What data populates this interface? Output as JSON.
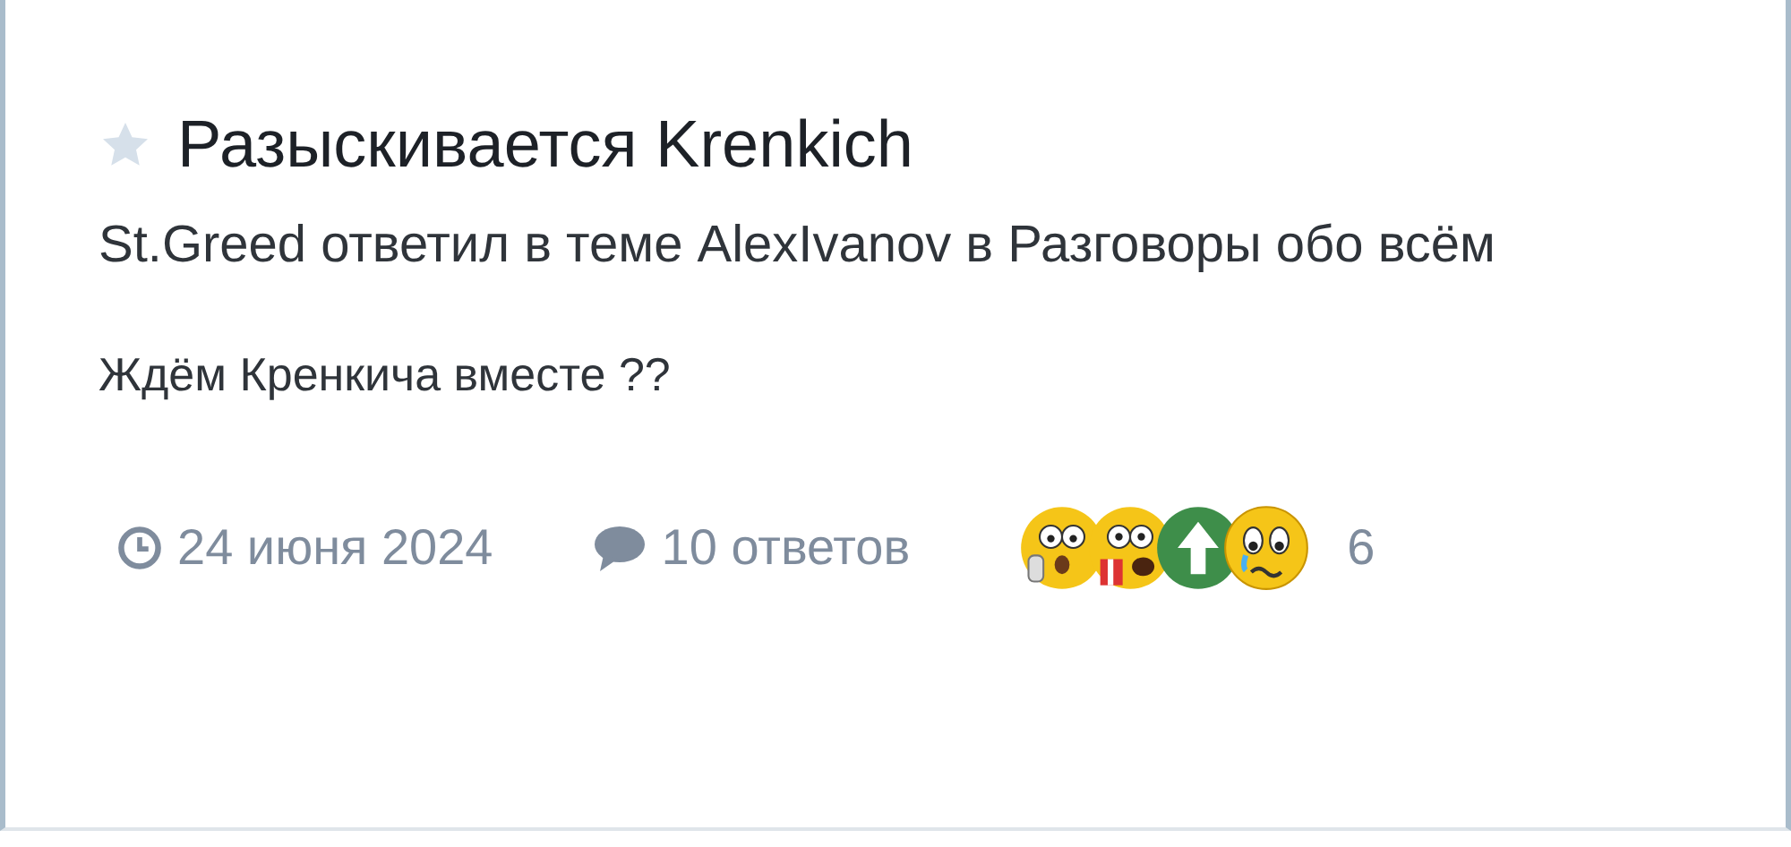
{
  "thread": {
    "title": "Разыскивается Krenkich",
    "starred": false,
    "summary": "St.Greed ответил в теме AlexIvanov в Разговоры обо всём",
    "snippet": "Ждём Кренкича вместе ??",
    "date": "24 июня 2024",
    "replies": "10 ответов",
    "reactions": [
      {
        "kind": "shocked"
      },
      {
        "kind": "popcorn"
      },
      {
        "kind": "upvote"
      },
      {
        "kind": "crying"
      }
    ],
    "reaction_count": "6"
  }
}
